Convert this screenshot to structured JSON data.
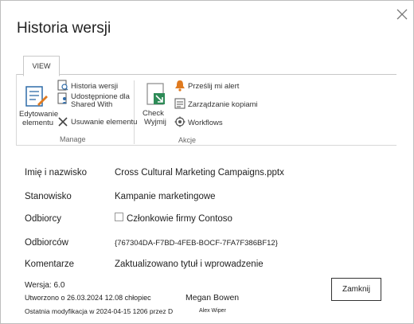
{
  "dialog": {
    "title": "Historia wersji"
  },
  "ribbon": {
    "tab_label": "VIEW",
    "manage": {
      "group_label": "Manage",
      "edit_item_label_line1": "Edytowanie",
      "edit_item_label_line2": "elementu",
      "version_history_label": "Historia wersji",
      "shared_with_line1": "Udostępnione dla",
      "shared_with_line2": "Shared With",
      "delete_item_label": "Usuwanie elementu"
    },
    "actions": {
      "group_label": "Akcje",
      "checkout_line1": "Check",
      "checkout_line2": "Wyjmij",
      "alert_me_label": "Prześlij mi alert",
      "manage_copies_label": "Zarządzanie kopiami",
      "workflows_label": "Workflows"
    }
  },
  "fields": [
    {
      "label": "Imię i nazwisko",
      "value": "Cross Cultural Marketing Campaigns.pptx"
    },
    {
      "label": "Stanowisko",
      "value": "Kampanie marketingowe"
    },
    {
      "label": "Odbiorcy",
      "value": "Członkowie firmy Contoso"
    },
    {
      "label": "Odbiorców",
      "value": "{767304DA-F7BD-4FEB-BOCF-7FA7F386BF12}"
    },
    {
      "label": "Komentarze",
      "value": "Zaktualizowano tytuł i wprowadzenie"
    }
  ],
  "footer": {
    "version": "Wersja: 6.0",
    "created": "Utworzono o 26.03.2024 12.08 chłopiec",
    "created_by": "Megan Bowen",
    "modified": "Ostatnia modyfikacja w 2024-04-15 1206 przez D",
    "modified_by": "Alex Wiper"
  },
  "buttons": {
    "close_label": "Zamknij"
  },
  "colors": {
    "accent_orange": "#e07a1f",
    "ribbon_blue": "#2f6ba8",
    "text": "#222222"
  }
}
